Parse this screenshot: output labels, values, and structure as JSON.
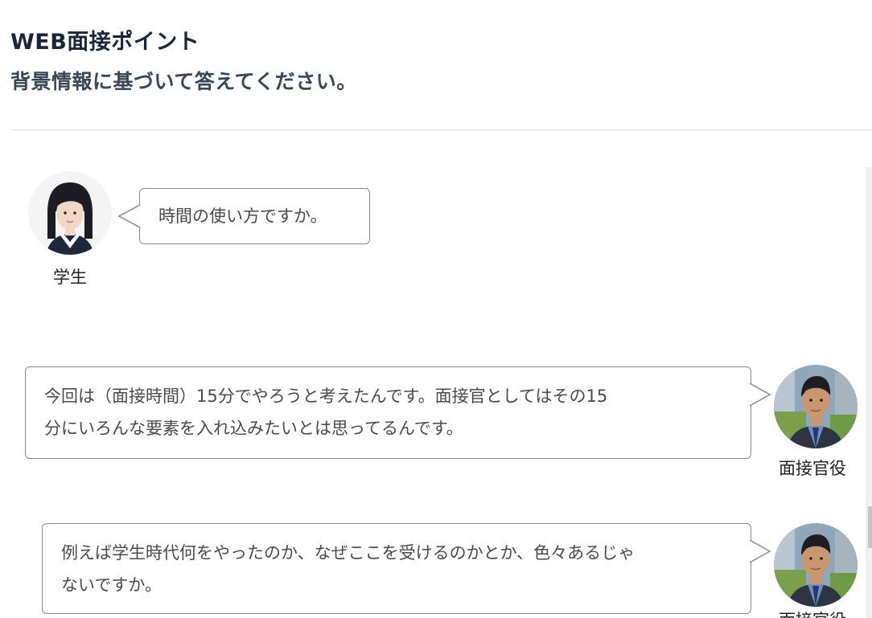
{
  "header": {
    "title": "WEB面接ポイント",
    "subtitle": "背景情報に基づいて答えてください。"
  },
  "messages": [
    {
      "speaker": "学生",
      "avatar_icon": "student-avatar",
      "side": "left",
      "text": "時間の使い方ですか。"
    },
    {
      "speaker": "面接官役",
      "avatar_icon": "interviewer-avatar",
      "side": "right",
      "text_lines": [
        "今回は（面接時間）15分でやろうと考えたんです。面接官としてはその15",
        "分にいろんな要素を入れ込みたいとは思ってるんです。"
      ]
    },
    {
      "speaker": "面接官役",
      "avatar_icon": "interviewer-avatar",
      "side": "right",
      "text_lines": [
        "例えば学生時代何をやったのか、なぜここを受けるのかとか、色々あるじゃ",
        "ないですか。"
      ]
    }
  ],
  "colors": {
    "title": "#1a2638",
    "bubble_border": "#8a8a8a",
    "bubble_text": "#4a4a4a"
  }
}
